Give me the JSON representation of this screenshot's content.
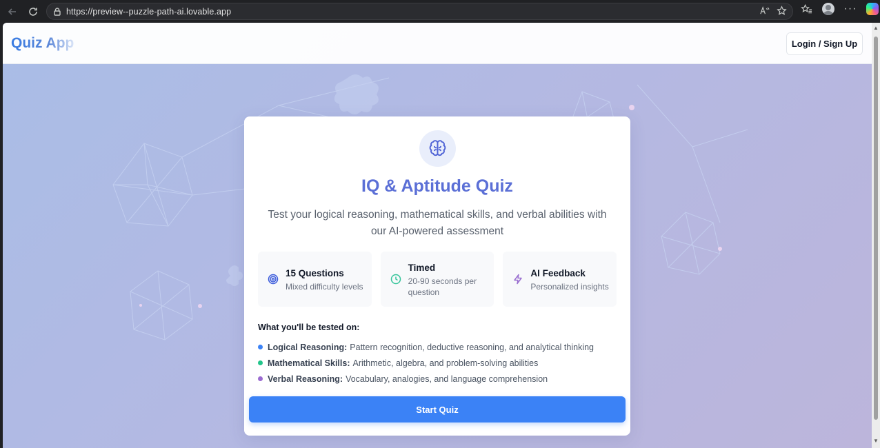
{
  "browser": {
    "url": "https://preview--puzzle-path-ai.lovable.app",
    "icons": [
      "back-arrow-icon",
      "reload-icon",
      "lock-icon",
      "read-aloud-icon",
      "favorite-star-icon",
      "favorites-icon",
      "profile-avatar-icon",
      "more-icon",
      "copilot-icon"
    ]
  },
  "header": {
    "brand": "Quiz App",
    "login_label": "Login / Sign Up"
  },
  "card": {
    "icon": "brain-icon",
    "title": "IQ & Aptitude Quiz",
    "subtitle": "Test your logical reasoning, mathematical skills, and verbal abilities with our AI-powered assessment",
    "features": [
      {
        "icon": "target-icon",
        "title": "15 Questions",
        "desc": "Mixed difficulty levels",
        "color": "#3b5bdb"
      },
      {
        "icon": "clock-icon",
        "title": "Timed",
        "desc": "20-90 seconds per question",
        "color": "#34c49a"
      },
      {
        "icon": "lightning-icon",
        "title": "AI Feedback",
        "desc": "Personalized insights",
        "color": "#9a6fd0"
      }
    ],
    "tested_title": "What you'll be tested on:",
    "tested": [
      {
        "label": "Logical Reasoning:",
        "text": "Pattern recognition, deductive reasoning, and analytical thinking",
        "color": "#3b82f6"
      },
      {
        "label": "Mathematical Skills:",
        "text": "Arithmetic, algebra, and problem-solving abilities",
        "color": "#22c58b"
      },
      {
        "label": "Verbal Reasoning:",
        "text": "Vocabulary, analogies, and language comprehension",
        "color": "#9b6bd1"
      }
    ],
    "start_label": "Start Quiz"
  }
}
